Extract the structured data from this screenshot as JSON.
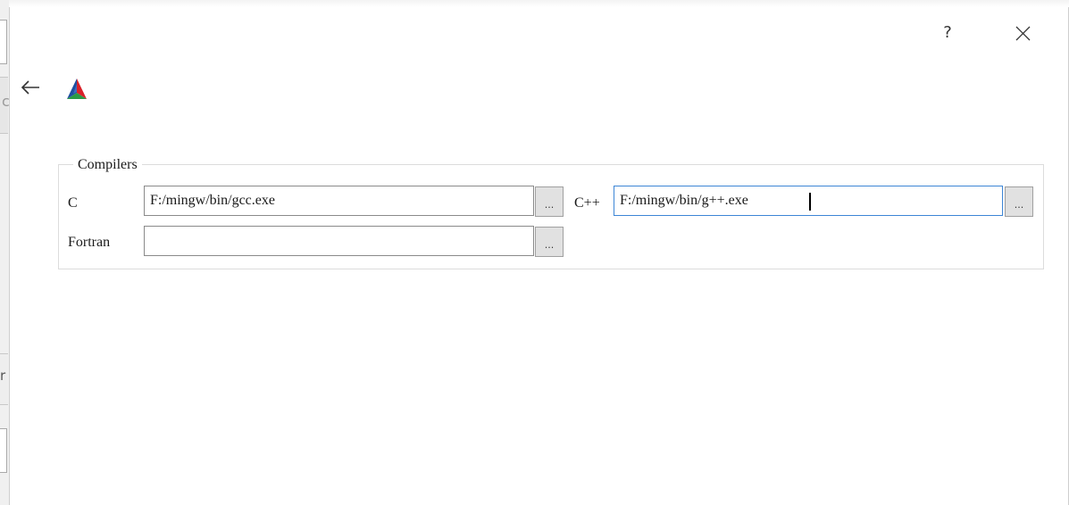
{
  "window": {
    "help_label": "?",
    "icons": {
      "close": "close-icon",
      "back": "back-arrow-icon",
      "logo": "cmake-logo-icon"
    }
  },
  "compilers": {
    "group_title": "Compilers",
    "c": {
      "label": "C",
      "value": "F:/mingw/bin/gcc.exe",
      "browse_label": "..."
    },
    "cxx": {
      "label": "C++",
      "value": "F:/mingw/bin/g++.exe",
      "browse_label": "..."
    },
    "fortran": {
      "label": "Fortran",
      "value": "",
      "browse_label": "..."
    }
  },
  "colors": {
    "focus_border": "#3d86d6",
    "logo_red": "#d9222a",
    "logo_blue": "#1f4ea0",
    "logo_green": "#2a9a45"
  }
}
